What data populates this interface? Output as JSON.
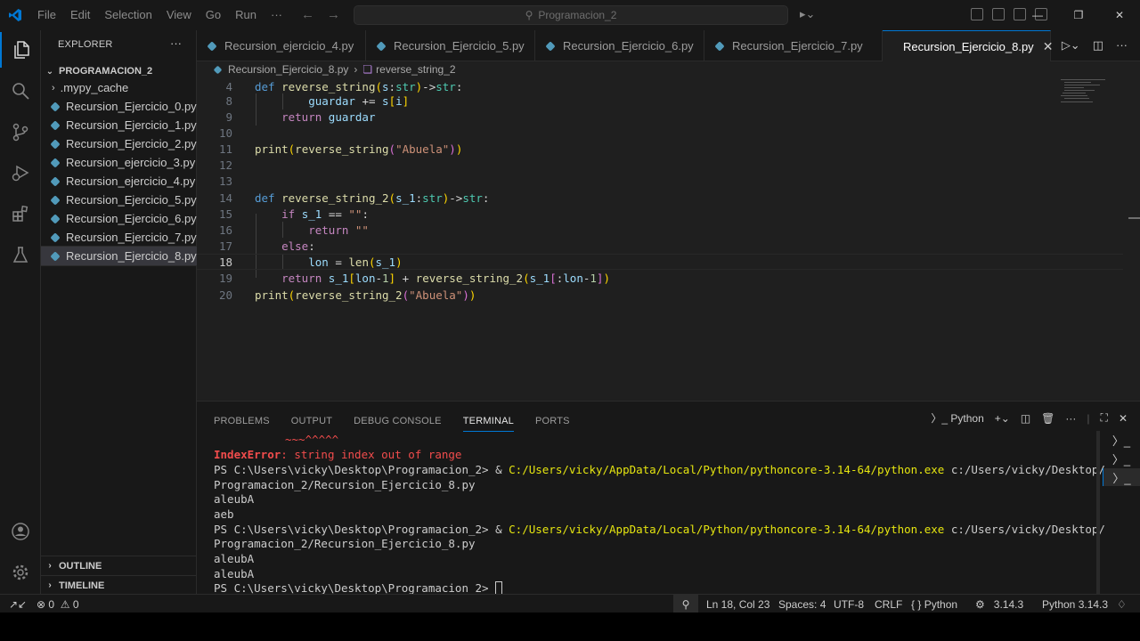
{
  "window": {
    "command_center": "Programacion_2"
  },
  "menu": [
    "File",
    "Edit",
    "Selection",
    "View",
    "Go",
    "Run",
    "···"
  ],
  "sidebar": {
    "title": "EXPLORER",
    "more": "···",
    "folder": "PROGRAMACION_2",
    "items": [
      {
        "label": ".mypy_cache",
        "type": "folder"
      },
      {
        "label": "Recursion_Ejercicio_0.py",
        "type": "py"
      },
      {
        "label": "Recursion_Ejercicio_1.py",
        "type": "py"
      },
      {
        "label": "Recursion_Ejercicio_2.py",
        "type": "py"
      },
      {
        "label": "Recursion_ejercicio_3.py",
        "type": "py"
      },
      {
        "label": "Recursion_ejercicio_4.py",
        "type": "py"
      },
      {
        "label": "Recursion_Ejercicio_5.py",
        "type": "py"
      },
      {
        "label": "Recursion_Ejercicio_6.py",
        "type": "py"
      },
      {
        "label": "Recursion_Ejercicio_7.py",
        "type": "py"
      },
      {
        "label": "Recursion_Ejercicio_8.py",
        "type": "py",
        "selected": true
      }
    ],
    "sections": [
      "OUTLINE",
      "TIMELINE"
    ]
  },
  "tabs": [
    {
      "label": "Recursion_ejercicio_4.py"
    },
    {
      "label": "Recursion_Ejercicio_5.py"
    },
    {
      "label": "Recursion_Ejercicio_6.py"
    },
    {
      "label": "Recursion_Ejercicio_7.py"
    },
    {
      "label": "Recursion_Ejercicio_8.py",
      "active": true
    }
  ],
  "breadcrumb": {
    "file": "Recursion_Ejercicio_8.py",
    "symbol": "reverse_string_2"
  },
  "editor": {
    "line_numbers": [
      "4",
      "8",
      "9",
      "10",
      "11",
      "12",
      "13",
      "14",
      "15",
      "16",
      "17",
      "18",
      "19",
      "20"
    ],
    "current_line": "18"
  },
  "panel": {
    "tabs": [
      "PROBLEMS",
      "OUTPUT",
      "DEBUG CONSOLE",
      "TERMINAL",
      "PORTS"
    ],
    "active_tab": "TERMINAL",
    "shell_label": "Python",
    "terminal": {
      "carets": "~~~^^^^^",
      "error_type": "IndexError",
      "error_msg": ": string index out of range",
      "prompt": "PS C:\\Users\\vicky\\Desktop\\Programacion_2> ",
      "amp": "& ",
      "exe": "C:/Users/vicky/AppData/Local/Python/pythoncore-3.14-64/python.exe",
      "arg1": " c:/Users/vicky/Desktop/",
      "arg2": "Programacion_2/Recursion_Ejercicio_8.py",
      "out1": "aleubA",
      "out2": "aeb",
      "out3": "aleubA",
      "out4": "aleubA"
    }
  },
  "status": {
    "errors": "0",
    "warnings": "0",
    "position": "Ln 18, Col 23",
    "spaces": "Spaces: 4",
    "encoding": "UTF-8",
    "eol": "CRLF",
    "language": "Python",
    "py_version": "3.14.3",
    "interpreter": "Python 3.14.3"
  },
  "colors": {
    "accent": "#0078d4",
    "python_icon": "#519aba",
    "error": "#f14c4c"
  }
}
